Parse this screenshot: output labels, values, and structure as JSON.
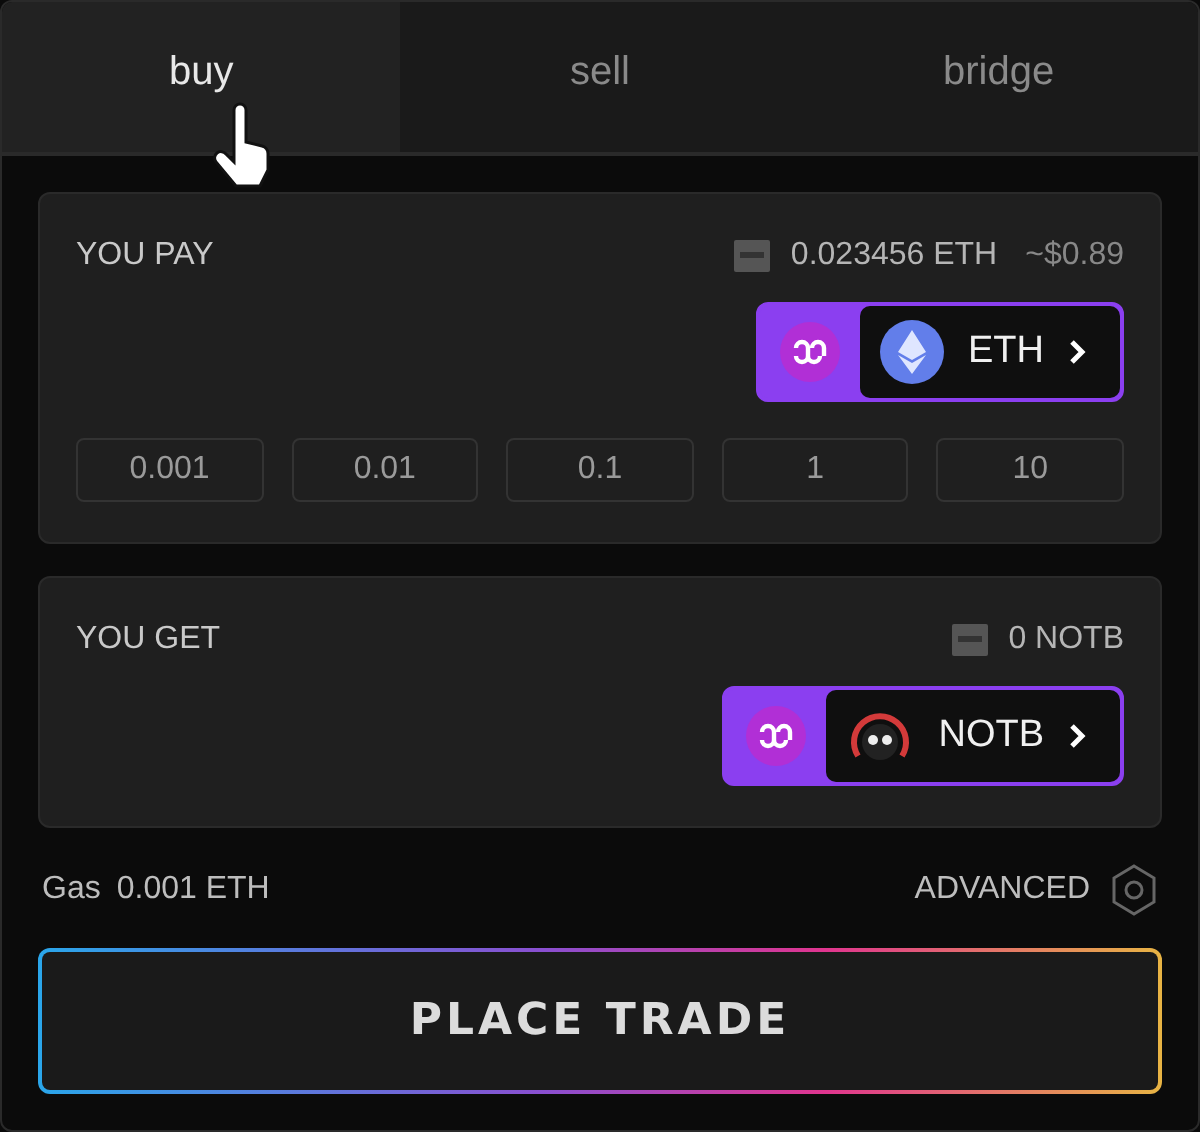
{
  "tabs": [
    {
      "label": "buy",
      "selected": true
    },
    {
      "label": "sell",
      "selected": false
    },
    {
      "label": "bridge",
      "selected": false
    }
  ],
  "pay": {
    "label": "YOU PAY",
    "balance": "0.023456 ETH",
    "usd": "~$0.89",
    "token": {
      "symbol": "ETH",
      "kind": "eth"
    },
    "presets": [
      "0.001",
      "0.01",
      "0.1",
      "1",
      "10"
    ]
  },
  "get": {
    "label": "YOU GET",
    "balance": "0 NOTB",
    "token": {
      "symbol": "NOTB",
      "kind": "notb"
    }
  },
  "gas": {
    "label": "Gas",
    "value": "0.001 ETH"
  },
  "advanced": "ADVANCED",
  "submit": "PLACE TRADE"
}
